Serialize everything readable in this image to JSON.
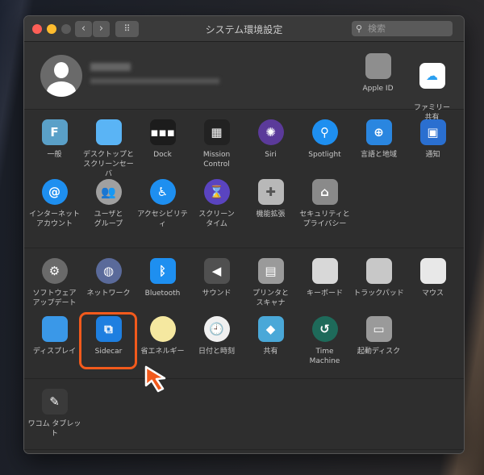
{
  "window": {
    "title": "システム環境設定",
    "search_placeholder": "検索",
    "back": "‹",
    "forward": "›",
    "grid": "⠿"
  },
  "user": {
    "apple_id": {
      "label": "Apple ID",
      "icon": "apple-icon",
      "color": "#8e8e8e"
    },
    "family": {
      "label": "ファミリー\n共有",
      "icon": "family-icon",
      "color": "#ffffff"
    }
  },
  "sections": [
    [
      [
        {
          "label": "一般",
          "icon": "general-icon",
          "color": "#5aa0c8",
          "glyph": "F"
        },
        {
          "label": "デスクトップと\nスクリーンセーバ",
          "icon": "desktop-icon",
          "color": "#5ab4f5",
          "glyph": ""
        },
        {
          "label": "Dock",
          "icon": "dock-icon",
          "color": "#1c1c1c",
          "glyph": "▪▪▪"
        },
        {
          "label": "Mission\nControl",
          "icon": "mission-control-icon",
          "color": "#222",
          "glyph": "▦"
        },
        {
          "label": "Siri",
          "icon": "siri-icon",
          "color": "#5b3a9a",
          "glyph": "✺",
          "round": true
        },
        {
          "label": "Spotlight",
          "icon": "spotlight-icon",
          "color": "#1e8ff0",
          "glyph": "⚲",
          "round": true
        },
        {
          "label": "言語と地域",
          "icon": "language-flag-icon",
          "color": "#2a86e0",
          "glyph": "⊕"
        },
        {
          "label": "通知",
          "icon": "notifications-icon",
          "color": "#2a6fd0",
          "glyph": "▣"
        }
      ],
      [
        {
          "label": "インターネット\nアカウント",
          "icon": "internet-accounts-icon",
          "color": "#1e8ff0",
          "glyph": "@",
          "round": true
        },
        {
          "label": "ユーザと\nグループ",
          "icon": "users-groups-icon",
          "color": "#a0a0a0",
          "glyph": "👥",
          "round": true
        },
        {
          "label": "アクセシビリティ",
          "icon": "accessibility-icon",
          "color": "#1e8ff0",
          "glyph": "♿",
          "round": true
        },
        {
          "label": "スクリーン\nタイム",
          "icon": "screen-time-icon",
          "color": "#5a44c0",
          "glyph": "⌛",
          "round": true
        },
        {
          "label": "機能拡張",
          "icon": "extensions-icon",
          "color": "#b8b8b8",
          "glyph": "✚"
        },
        {
          "label": "セキュリティと\nプライバシー",
          "icon": "security-icon",
          "color": "#8a8a8a",
          "glyph": "⌂"
        }
      ]
    ],
    [
      [
        {
          "label": "ソフトウェア\nアップデート",
          "icon": "software-update-icon",
          "color": "#6a6a6a",
          "glyph": "⚙",
          "round": true
        },
        {
          "label": "ネットワーク",
          "icon": "network-icon",
          "color": "#5a6a9a",
          "glyph": "◍",
          "round": true
        },
        {
          "label": "Bluetooth",
          "icon": "bluetooth-icon",
          "color": "#1e8ff0",
          "glyph": "ᛒ"
        },
        {
          "label": "サウンド",
          "icon": "sound-icon",
          "color": "#505050",
          "glyph": "◀"
        },
        {
          "label": "プリンタと\nスキャナ",
          "icon": "printer-icon",
          "color": "#9a9a9a",
          "glyph": "▤"
        },
        {
          "label": "キーボード",
          "icon": "keyboard-icon",
          "color": "#d8d8d8",
          "glyph": ""
        },
        {
          "label": "トラックパッド",
          "icon": "trackpad-icon",
          "color": "#c8c8c8",
          "glyph": ""
        },
        {
          "label": "マウス",
          "icon": "mouse-icon",
          "color": "#e8e8e8",
          "glyph": ""
        }
      ],
      [
        {
          "label": "ディスプレイ",
          "icon": "display-icon",
          "color": "#3a98e8",
          "glyph": ""
        },
        {
          "label": "Sidecar",
          "icon": "sidecar-icon",
          "color": "#1e7fe0",
          "glyph": "⧉"
        },
        {
          "label": "省エネルギー",
          "icon": "energy-saver-bulb-icon",
          "color": "#f5e8a0",
          "glyph": "",
          "round": true
        },
        {
          "label": "日付と時刻",
          "icon": "date-time-clock-icon",
          "color": "#f0f0f0",
          "glyph": "🕘",
          "round": true
        },
        {
          "label": "共有",
          "icon": "sharing-folder-icon",
          "color": "#4aa8d8",
          "glyph": "◆"
        },
        {
          "label": "Time\nMachine",
          "icon": "time-machine-icon",
          "color": "#1e6a5a",
          "glyph": "↺",
          "round": true
        },
        {
          "label": "起動ディスク",
          "icon": "startup-disk-icon",
          "color": "#9a9a9a",
          "glyph": "▭"
        }
      ]
    ],
    [
      [
        {
          "label": "ワコム タブレット",
          "icon": "wacom-tablet-icon",
          "color": "#3a3a3a",
          "glyph": "✎"
        }
      ]
    ]
  ],
  "colors": {
    "highlight": "#f25a1c",
    "close": "#fe5f57",
    "minimize": "#febc2e",
    "zoom": "#5a5a5a"
  }
}
